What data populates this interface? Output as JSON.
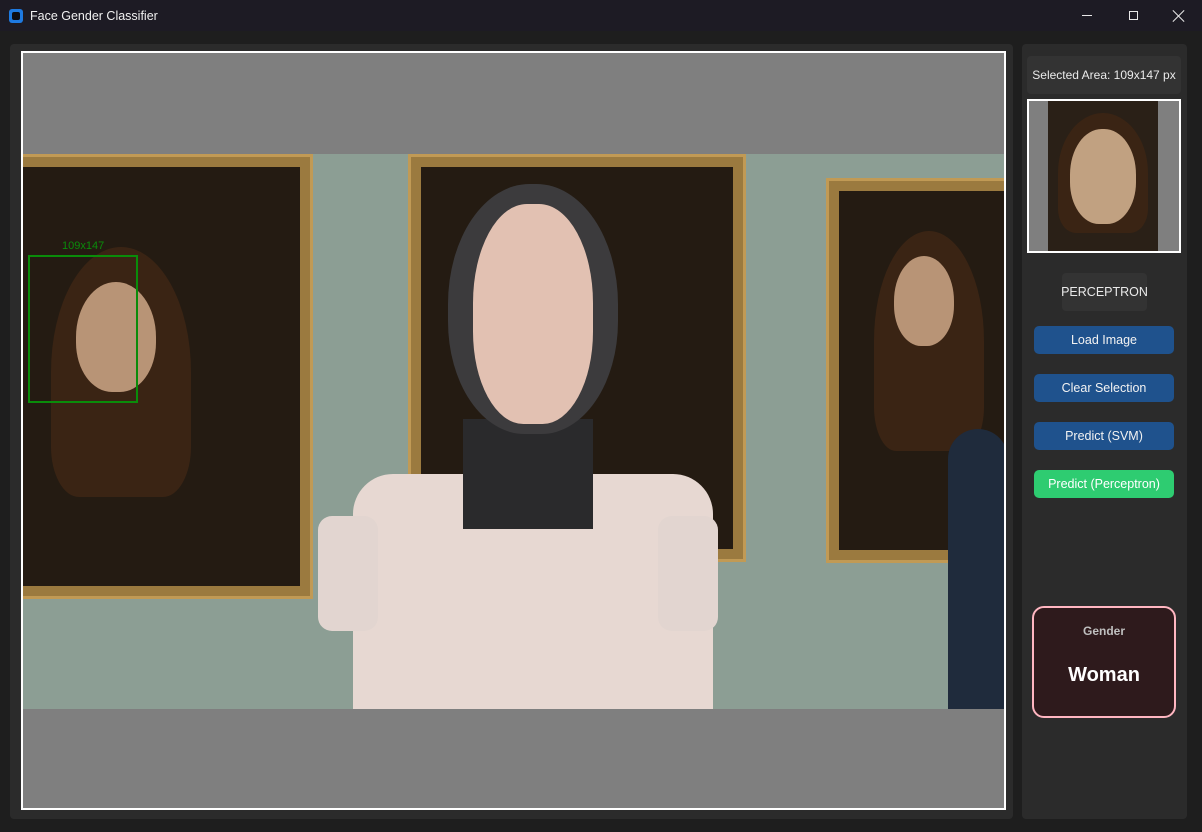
{
  "window": {
    "title": "Face Gender Classifier",
    "controls": [
      "minimize",
      "maximize",
      "close"
    ]
  },
  "canvas": {
    "selection_label": "109x147"
  },
  "sidebar": {
    "selected_area_text": "Selected Area: 109x147 px",
    "model_label": "PERCEPTRON",
    "buttons": {
      "load": "Load Image",
      "clear": "Clear Selection",
      "predict_svm": "Predict (SVM)",
      "predict_perceptron": "Predict (Perceptron)"
    },
    "result": {
      "label": "Gender",
      "value": "Woman"
    }
  },
  "colors": {
    "primary_button": "#1f528d",
    "active_button": "#2ecc71",
    "selection_box": "#0a8c0a",
    "result_border": "#ffb6c1"
  }
}
